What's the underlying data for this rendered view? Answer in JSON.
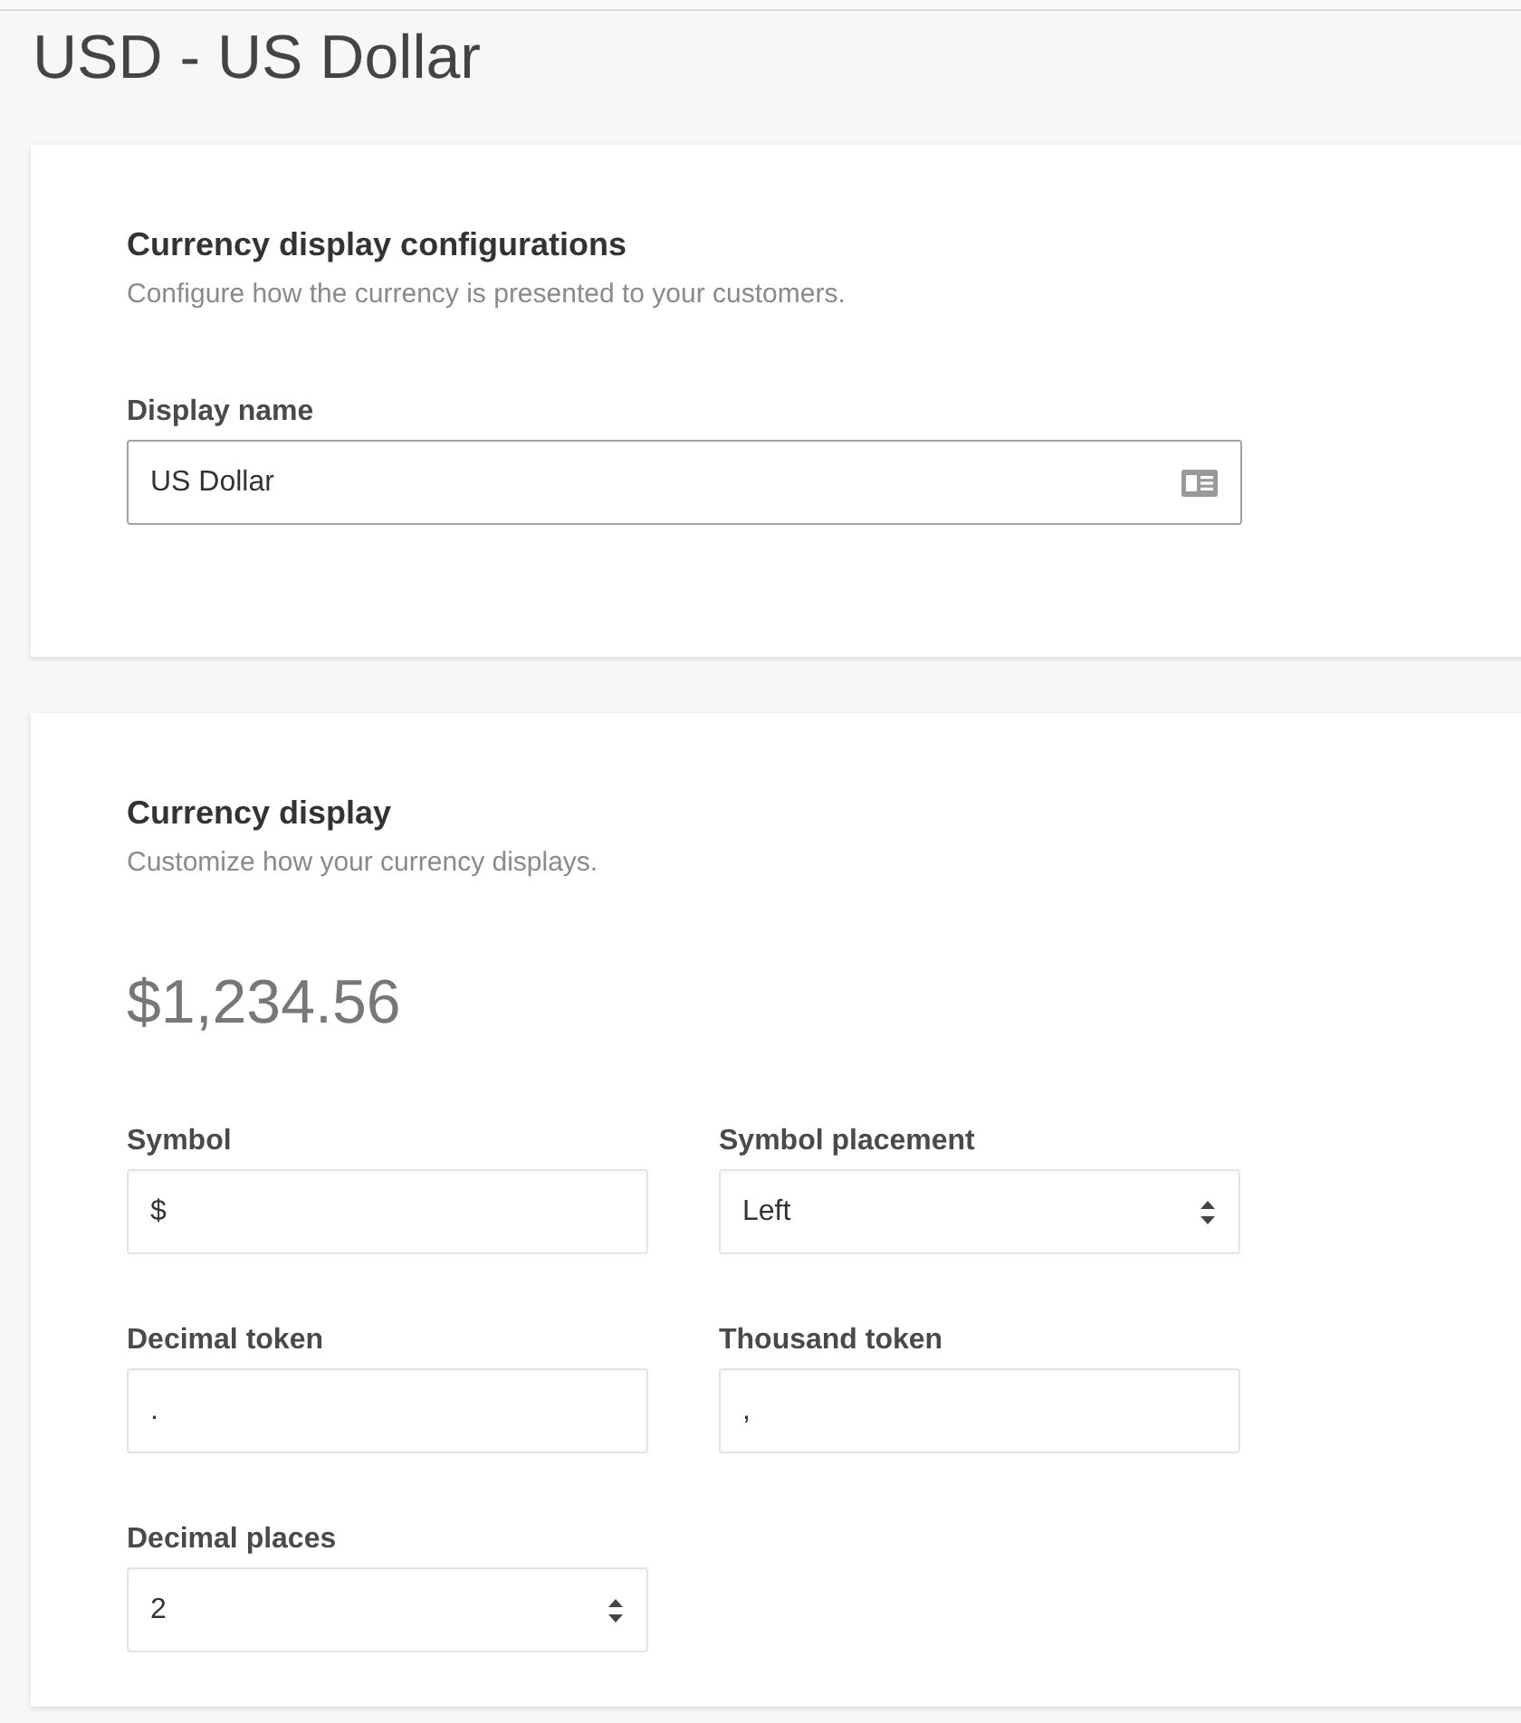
{
  "page": {
    "title": "USD - US Dollar"
  },
  "sections": [
    {
      "title": "Currency display configurations",
      "subtitle": "Configure how the currency is presented to your customers.",
      "fields": [
        {
          "kind": "contact",
          "label": "Display name",
          "value": "US Dollar"
        }
      ]
    },
    {
      "title": "Currency display",
      "subtitle": "Customize how your currency displays.",
      "preview": "$1,234.56",
      "fields": [
        {
          "kind": "text",
          "label": "Symbol",
          "value": "$"
        },
        {
          "kind": "select",
          "label": "Symbol placement",
          "value": "Left"
        },
        {
          "kind": "text",
          "label": "Decimal token",
          "value": "."
        },
        {
          "kind": "text",
          "label": "Thousand token",
          "value": ","
        },
        {
          "kind": "number",
          "label": "Decimal places",
          "value": "2"
        }
      ]
    }
  ]
}
